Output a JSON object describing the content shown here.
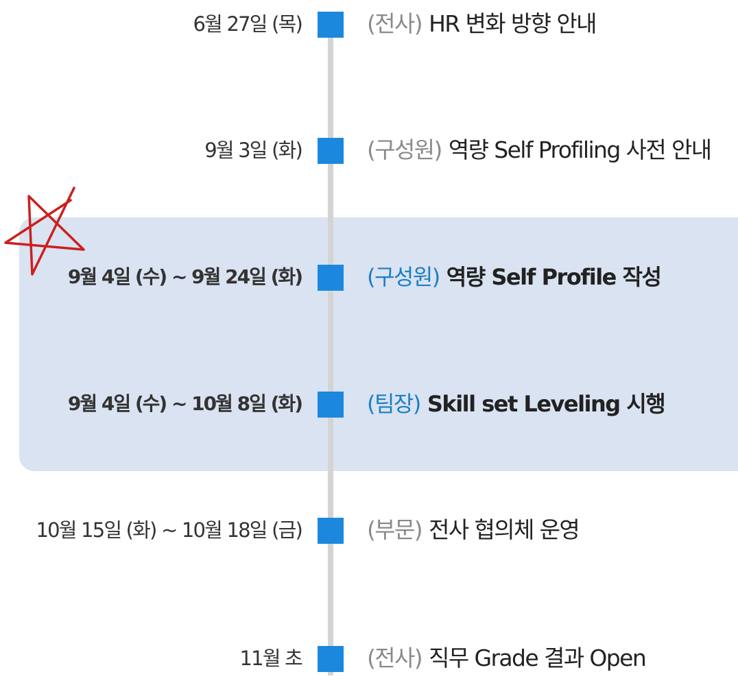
{
  "timeline": {
    "highlight_color": "#dae3f1",
    "marker_color": "#1b88de",
    "events": [
      {
        "date": "6월 27일 (목)",
        "tag": "(전사)",
        "title": "HR 변화 방향 안내",
        "highlighted": false
      },
      {
        "date": "9월 3일 (화)",
        "tag": "(구성원)",
        "title": "역량 Self Profiling 사전 안내",
        "highlighted": false
      },
      {
        "date": "9월 4일 (수) ~ 9월 24일 (화)",
        "tag": "(구성원)",
        "title": "역량 Self Profile 작성",
        "highlighted": true
      },
      {
        "date": "9월 4일 (수) ~ 10월 8일 (화)",
        "tag": "(팀장)",
        "title": "Skill set Leveling 시행",
        "highlighted": true
      },
      {
        "date": "10월 15일 (화) ~ 10월 18일 (금)",
        "tag": "(부문)",
        "title": "전사 협의체 운영",
        "highlighted": false
      },
      {
        "date": "11월 초",
        "tag": "(전사)",
        "title": "직무 Grade 결과 Open",
        "highlighted": false
      }
    ]
  },
  "annotation": {
    "icon": "hand-drawn-star-icon",
    "color": "#cc1f1f"
  }
}
